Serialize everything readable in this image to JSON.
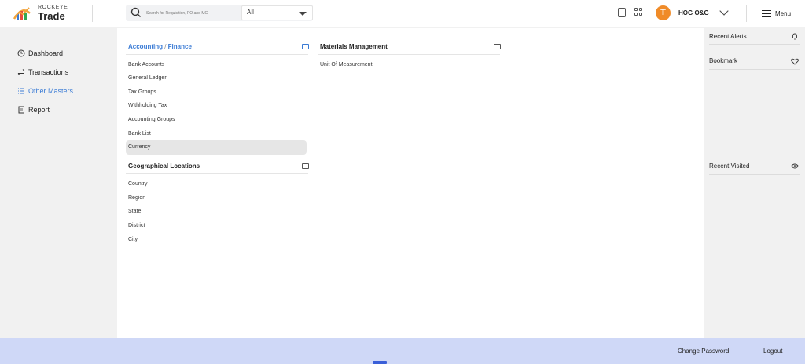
{
  "app": {
    "logo_small": "ROCKEYE",
    "logo_big": "Trade"
  },
  "search": {
    "placeholder": "Search for Requisition, PO and MC",
    "scope": "All"
  },
  "header": {
    "avatar_initial": "T",
    "org_name": "HOG O&G",
    "menu_label": "Menu"
  },
  "sidebar": {
    "items": [
      {
        "label": "Dashboard",
        "icon": "clock-icon"
      },
      {
        "label": "Transactions",
        "icon": "transfer-icon"
      },
      {
        "label": "Other Masters",
        "icon": "list-icon",
        "active": true
      },
      {
        "label": "Report",
        "icon": "document-icon"
      }
    ]
  },
  "masters": {
    "accounting": {
      "title_part1": "Accounting",
      "separator": " / ",
      "title_part2": "Finance",
      "items": [
        "Bank Accounts",
        "General Ledger",
        "Tax Groups",
        "Withholding Tax",
        "Accounting Groups",
        "Bank List",
        "Currency"
      ],
      "selected": "Currency"
    },
    "geo": {
      "title": "Geographical Locations",
      "items": [
        "Country",
        "Region",
        "State",
        "District",
        "City"
      ]
    },
    "materials": {
      "title": "Materials Management",
      "items": [
        "Unit Of Measurement"
      ]
    }
  },
  "right_panel": {
    "recent_alerts": "Recent Alerts",
    "bookmark": "Bookmark",
    "recent_visited": "Recent Visited"
  },
  "footer": {
    "change_password": "Change Password",
    "logout": "Logout"
  },
  "colors": {
    "accent": "#3a7bd5",
    "avatar": "#f08b28",
    "footer_bg": "#cfd8f7"
  }
}
